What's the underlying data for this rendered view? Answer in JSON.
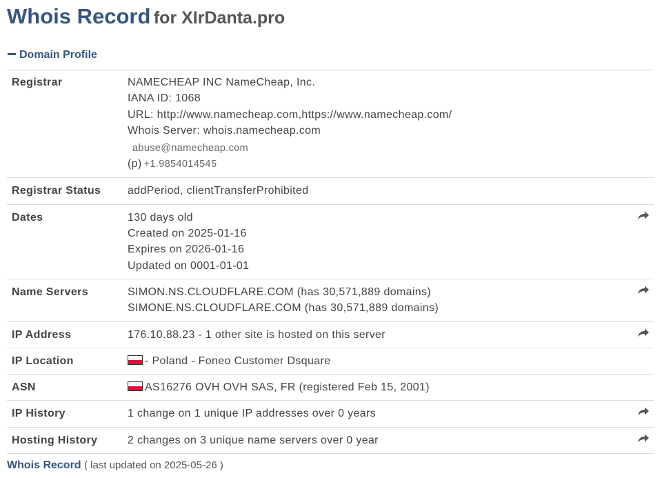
{
  "header": {
    "title_main": "Whois Record",
    "title_rest": "for XIrDanta.pro"
  },
  "section": {
    "label": "Domain Profile"
  },
  "rows": {
    "registrar": {
      "label": "Registrar",
      "lines": [
        "NAMECHEAP INC NameCheap, Inc.",
        "IANA ID: 1068",
        "URL: http://www.namecheap.com,https://www.namecheap.com/",
        "Whois Server: whois.namecheap.com"
      ],
      "abuse_email": "abuse@namecheap.com",
      "phone_label": "(p)",
      "phone": "+1.9854014545"
    },
    "status": {
      "label": "Registrar Status",
      "value": "addPeriod, clientTransferProhibited"
    },
    "dates": {
      "label": "Dates",
      "lines": [
        "130 days old",
        "Created on 2025-01-16",
        "Expires on 2026-01-16",
        "Updated on 0001-01-01"
      ]
    },
    "nameservers": {
      "label": "Name Servers",
      "lines": [
        "SIMON.NS.CLOUDFLARE.COM (has 30,571,889 domains)",
        "SIMONE.NS.CLOUDFLARE.COM (has 30,571,889 domains)"
      ]
    },
    "ip": {
      "label": "IP Address",
      "value": "176.10.88.23 - 1 other site is hosted on this server"
    },
    "location": {
      "label": "IP Location",
      "value": "- Poland - Foneo Customer Dsquare"
    },
    "asn": {
      "label": "ASN",
      "value": "AS16276 OVH OVH SAS, FR (registered Feb 15, 2001)"
    },
    "ip_history": {
      "label": "IP History",
      "value": "1 change on 1 unique IP addresses over 0 years"
    },
    "hosting_history": {
      "label": "Hosting History",
      "value": "2 changes on 3 unique name servers over 0 year"
    }
  },
  "footer": {
    "link": "Whois Record",
    "note": "( last updated on 2025-05-26 )"
  },
  "icons": {
    "share": "share-arrow-icon",
    "collapse": "minus-icon",
    "flag": "poland-flag-icon"
  },
  "colors": {
    "accent": "#35567f",
    "text": "#444444",
    "icon": "#555555"
  }
}
